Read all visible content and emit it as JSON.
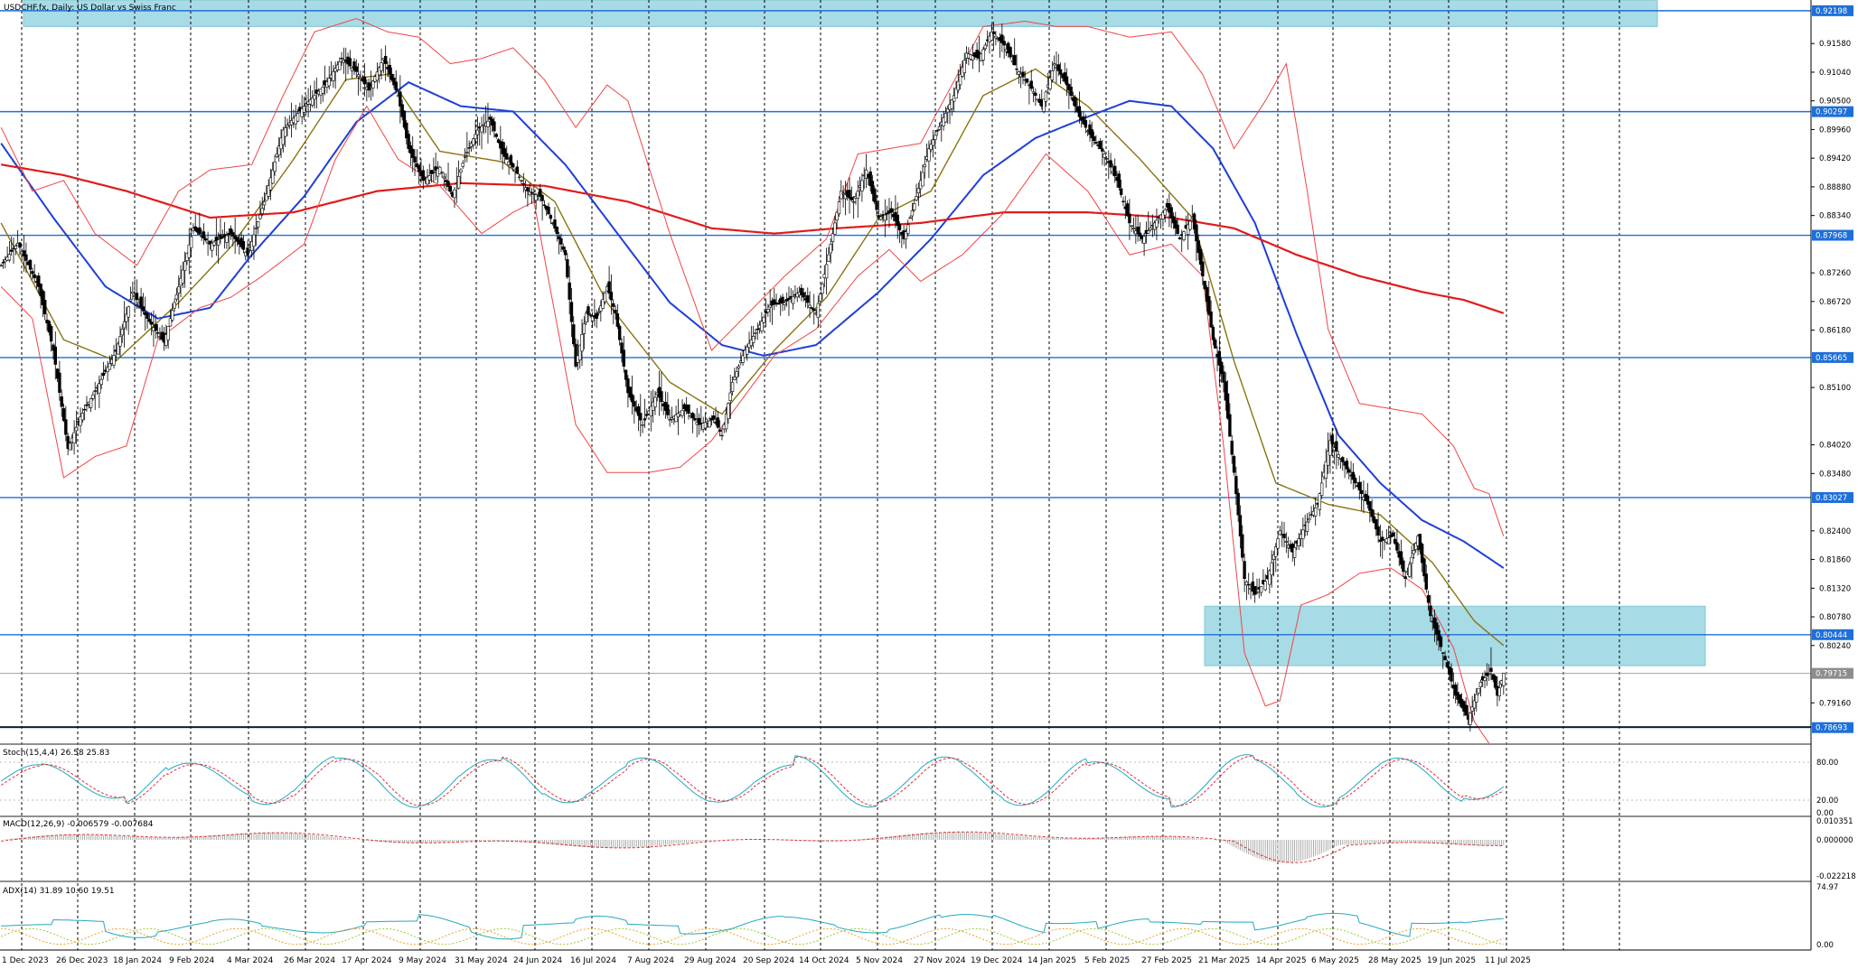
{
  "chart_data": {
    "type": "candlestick",
    "title": "USDCHF.fx, Daily:  US Dollar vs Swiss Franc",
    "ylim": [
      0.7845,
      0.924
    ],
    "price_ticks": [
      "0.91580",
      "0.91040",
      "0.90500",
      "0.89960",
      "0.89420",
      "0.88880",
      "0.88340",
      "0.87260",
      "0.86720",
      "0.86180",
      "0.85100",
      "0.84020",
      "0.83480",
      "0.82400",
      "0.81860",
      "0.81320",
      "0.80780",
      "0.80240",
      "0.79160"
    ],
    "price_tick_values": [
      0.9158,
      0.9104,
      0.905,
      0.8996,
      0.8942,
      0.8888,
      0.8834,
      0.8726,
      0.8672,
      0.8618,
      0.851,
      0.8402,
      0.8348,
      0.824,
      0.8186,
      0.8132,
      0.8078,
      0.8024,
      0.7916
    ],
    "horizontal_levels": [
      {
        "label": "0.92198",
        "value": 0.92198
      },
      {
        "label": "0.90297",
        "value": 0.90297
      },
      {
        "label": "0.87968",
        "value": 0.87968
      },
      {
        "label": "0.85665",
        "value": 0.85665
      },
      {
        "label": "0.83027",
        "value": 0.83027
      },
      {
        "label": "0.80444",
        "value": 0.80444
      }
    ],
    "current_price": {
      "label": "0.79715",
      "value": 0.79715
    },
    "low_marker": {
      "label": "0.78693",
      "value": 0.78693
    },
    "zones": [
      {
        "from_date": "1 Dec 2023",
        "to_date": "2 Aug 2025",
        "top": 0.924,
        "bottom": 0.919
      },
      {
        "from_date": "26 Mar 2025",
        "to_date": "1 Jul 2025 + 25d",
        "top": 0.8098,
        "bottom": 0.7986
      }
    ],
    "x_labels": [
      "1 Dec 2023",
      "26 Dec 2023",
      "18 Jan 2024",
      "9 Feb 2024",
      "4 Mar 2024",
      "26 Mar 2024",
      "17 Apr 2024",
      "9 May 2024",
      "31 May 2024",
      "24 Jun 2024",
      "16 Jul 2024",
      "7 Aug 2024",
      "29 Aug 2024",
      "20 Sep 2024",
      "14 Oct 2024",
      "5 Nov 2024",
      "27 Nov 2024",
      "19 Dec 2024",
      "14 Jan 2025",
      "5 Feb 2025",
      "27 Feb 2025",
      "21 Mar 2025",
      "14 Apr 2025",
      "6 May 2025",
      "28 May 2025",
      "19 Jun 2025",
      "11 Jul 2025"
    ],
    "close_path": [
      [
        0,
        0.874
      ],
      [
        8,
        0.8782
      ],
      [
        18,
        0.87
      ],
      [
        25,
        0.858
      ],
      [
        32,
        0.8395
      ],
      [
        38,
        0.8455
      ],
      [
        46,
        0.851
      ],
      [
        55,
        0.8578
      ],
      [
        63,
        0.869
      ],
      [
        70,
        0.864
      ],
      [
        78,
        0.8595
      ],
      [
        85,
        0.87
      ],
      [
        92,
        0.881
      ],
      [
        100,
        0.878
      ],
      [
        110,
        0.88
      ],
      [
        118,
        0.876
      ],
      [
        126,
        0.886
      ],
      [
        135,
        0.8995
      ],
      [
        145,
        0.904
      ],
      [
        155,
        0.908
      ],
      [
        163,
        0.913
      ],
      [
        170,
        0.9105
      ],
      [
        176,
        0.907
      ],
      [
        183,
        0.913
      ],
      [
        190,
        0.906
      ],
      [
        195,
        0.896
      ],
      [
        202,
        0.89
      ],
      [
        210,
        0.8925
      ],
      [
        216,
        0.887
      ],
      [
        222,
        0.8945
      ],
      [
        228,
        0.8995
      ],
      [
        234,
        0.9015
      ],
      [
        240,
        0.895
      ],
      [
        246,
        0.892
      ],
      [
        252,
        0.888
      ],
      [
        258,
        0.887
      ],
      [
        264,
        0.882
      ],
      [
        270,
        0.876
      ],
      [
        275,
        0.855
      ],
      [
        280,
        0.865
      ],
      [
        285,
        0.864
      ],
      [
        290,
        0.87
      ],
      [
        294,
        0.865
      ],
      [
        300,
        0.85
      ],
      [
        307,
        0.844
      ],
      [
        314,
        0.85
      ],
      [
        320,
        0.845
      ],
      [
        327,
        0.847
      ],
      [
        334,
        0.844
      ],
      [
        341,
        0.845
      ],
      [
        345,
        0.842
      ],
      [
        350,
        0.852
      ],
      [
        356,
        0.858
      ],
      [
        362,
        0.862
      ],
      [
        368,
        0.8665
      ],
      [
        375,
        0.867
      ],
      [
        382,
        0.869
      ],
      [
        390,
        0.865
      ],
      [
        396,
        0.876
      ],
      [
        402,
        0.888
      ],
      [
        408,
        0.886
      ],
      [
        414,
        0.892
      ],
      [
        420,
        0.883
      ],
      [
        426,
        0.884
      ],
      [
        432,
        0.879
      ],
      [
        438,
        0.887
      ],
      [
        444,
        0.896
      ],
      [
        450,
        0.901
      ],
      [
        456,
        0.906
      ],
      [
        462,
        0.914
      ],
      [
        468,
        0.913
      ],
      [
        474,
        0.918
      ],
      [
        480,
        0.9155
      ],
      [
        486,
        0.911
      ],
      [
        492,
        0.908
      ],
      [
        498,
        0.904
      ],
      [
        504,
        0.912
      ],
      [
        510,
        0.908
      ],
      [
        516,
        0.902
      ],
      [
        522,
        0.898
      ],
      [
        528,
        0.895
      ],
      [
        534,
        0.89
      ],
      [
        540,
        0.882
      ],
      [
        546,
        0.879
      ],
      [
        552,
        0.882
      ],
      [
        558,
        0.885
      ],
      [
        564,
        0.879
      ],
      [
        570,
        0.883
      ],
      [
        575,
        0.872
      ],
      [
        580,
        0.86
      ],
      [
        585,
        0.852
      ],
      [
        590,
        0.835
      ],
      [
        595,
        0.815
      ],
      [
        600,
        0.812
      ],
      [
        606,
        0.815
      ],
      [
        612,
        0.824
      ],
      [
        618,
        0.82
      ],
      [
        624,
        0.825
      ],
      [
        630,
        0.829
      ],
      [
        636,
        0.841
      ],
      [
        642,
        0.837
      ],
      [
        648,
        0.833
      ],
      [
        654,
        0.829
      ],
      [
        660,
        0.822
      ],
      [
        666,
        0.823
      ],
      [
        672,
        0.815
      ],
      [
        678,
        0.823
      ],
      [
        684,
        0.808
      ],
      [
        690,
        0.801
      ],
      [
        696,
        0.793
      ],
      [
        702,
        0.7885
      ],
      [
        708,
        0.7955
      ],
      [
        713,
        0.7975
      ],
      [
        716,
        0.793
      ],
      [
        719,
        0.7972
      ]
    ],
    "series": [
      {
        "name": "EMA 21 (olive)",
        "values": [
          [
            0,
            0.882
          ],
          [
            30,
            0.86
          ],
          [
            55,
            0.856
          ],
          [
            85,
            0.867
          ],
          [
            110,
            0.8775
          ],
          [
            140,
            0.894
          ],
          [
            165,
            0.909
          ],
          [
            185,
            0.91
          ],
          [
            210,
            0.8955
          ],
          [
            240,
            0.8935
          ],
          [
            265,
            0.886
          ],
          [
            290,
            0.867
          ],
          [
            320,
            0.852
          ],
          [
            345,
            0.846
          ],
          [
            370,
            0.858
          ],
          [
            395,
            0.868
          ],
          [
            420,
            0.883
          ],
          [
            445,
            0.888
          ],
          [
            470,
            0.906
          ],
          [
            495,
            0.911
          ],
          [
            520,
            0.904
          ],
          [
            545,
            0.894
          ],
          [
            570,
            0.883
          ],
          [
            590,
            0.856
          ],
          [
            610,
            0.833
          ],
          [
            635,
            0.829
          ],
          [
            660,
            0.827
          ],
          [
            685,
            0.818
          ],
          [
            705,
            0.807
          ],
          [
            719,
            0.8024
          ]
        ]
      },
      {
        "name": "EMA 50 (blue)",
        "values": [
          [
            0,
            0.897
          ],
          [
            25,
            0.883
          ],
          [
            50,
            0.87
          ],
          [
            75,
            0.864
          ],
          [
            100,
            0.866
          ],
          [
            120,
            0.876
          ],
          [
            145,
            0.887
          ],
          [
            170,
            0.901
          ],
          [
            195,
            0.9085
          ],
          [
            220,
            0.904
          ],
          [
            245,
            0.903
          ],
          [
            270,
            0.893
          ],
          [
            295,
            0.88
          ],
          [
            320,
            0.867
          ],
          [
            345,
            0.859
          ],
          [
            365,
            0.857
          ],
          [
            390,
            0.859
          ],
          [
            420,
            0.869
          ],
          [
            445,
            0.879
          ],
          [
            470,
            0.891
          ],
          [
            495,
            0.898
          ],
          [
            520,
            0.902
          ],
          [
            540,
            0.905
          ],
          [
            560,
            0.904
          ],
          [
            580,
            0.896
          ],
          [
            600,
            0.882
          ],
          [
            620,
            0.861
          ],
          [
            640,
            0.842
          ],
          [
            660,
            0.833
          ],
          [
            680,
            0.826
          ],
          [
            700,
            0.822
          ],
          [
            719,
            0.817
          ]
        ]
      },
      {
        "name": "EMA 200 (red)",
        "values": [
          [
            0,
            0.893
          ],
          [
            30,
            0.891
          ],
          [
            60,
            0.888
          ],
          [
            100,
            0.883
          ],
          [
            140,
            0.884
          ],
          [
            180,
            0.888
          ],
          [
            220,
            0.8895
          ],
          [
            260,
            0.889
          ],
          [
            300,
            0.886
          ],
          [
            340,
            0.881
          ],
          [
            370,
            0.88
          ],
          [
            400,
            0.881
          ],
          [
            440,
            0.882
          ],
          [
            480,
            0.884
          ],
          [
            520,
            0.884
          ],
          [
            560,
            0.883
          ],
          [
            590,
            0.881
          ],
          [
            620,
            0.876
          ],
          [
            650,
            0.872
          ],
          [
            680,
            0.869
          ],
          [
            700,
            0.8675
          ],
          [
            719,
            0.865
          ]
        ]
      },
      {
        "name": "Bollinger upper",
        "values": [
          [
            0,
            0.9
          ],
          [
            15,
            0.888
          ],
          [
            30,
            0.89
          ],
          [
            45,
            0.88
          ],
          [
            65,
            0.874
          ],
          [
            85,
            0.888
          ],
          [
            100,
            0.892
          ],
          [
            120,
            0.893
          ],
          [
            135,
            0.906
          ],
          [
            150,
            0.918
          ],
          [
            170,
            0.9205
          ],
          [
            185,
            0.918
          ],
          [
            200,
            0.917
          ],
          [
            215,
            0.912
          ],
          [
            230,
            0.913
          ],
          [
            245,
            0.915
          ],
          [
            260,
            0.909
          ],
          [
            275,
            0.9
          ],
          [
            290,
            0.908
          ],
          [
            300,
            0.905
          ],
          [
            320,
            0.88
          ],
          [
            340,
            0.858
          ],
          [
            355,
            0.864
          ],
          [
            375,
            0.872
          ],
          [
            395,
            0.879
          ],
          [
            410,
            0.895
          ],
          [
            425,
            0.896
          ],
          [
            440,
            0.897
          ],
          [
            455,
            0.908
          ],
          [
            470,
            0.919
          ],
          [
            490,
            0.92
          ],
          [
            505,
            0.919
          ],
          [
            520,
            0.919
          ],
          [
            540,
            0.917
          ],
          [
            560,
            0.918
          ],
          [
            575,
            0.91
          ],
          [
            590,
            0.896
          ],
          [
            605,
            0.905
          ],
          [
            615,
            0.912
          ],
          [
            625,
            0.888
          ],
          [
            635,
            0.862
          ],
          [
            650,
            0.848
          ],
          [
            665,
            0.847
          ],
          [
            680,
            0.846
          ],
          [
            695,
            0.84
          ],
          [
            705,
            0.832
          ],
          [
            712,
            0.831
          ],
          [
            719,
            0.823
          ]
        ]
      },
      {
        "name": "Bollinger lower",
        "values": [
          [
            0,
            0.87
          ],
          [
            15,
            0.864
          ],
          [
            30,
            0.834
          ],
          [
            45,
            0.838
          ],
          [
            60,
            0.84
          ],
          [
            75,
            0.86
          ],
          [
            95,
            0.866
          ],
          [
            110,
            0.868
          ],
          [
            125,
            0.872
          ],
          [
            145,
            0.878
          ],
          [
            160,
            0.894
          ],
          [
            175,
            0.904
          ],
          [
            190,
            0.894
          ],
          [
            210,
            0.889
          ],
          [
            230,
            0.88
          ],
          [
            245,
            0.884
          ],
          [
            255,
            0.886
          ],
          [
            275,
            0.844
          ],
          [
            290,
            0.835
          ],
          [
            310,
            0.835
          ],
          [
            325,
            0.836
          ],
          [
            340,
            0.841
          ],
          [
            355,
            0.849
          ],
          [
            370,
            0.857
          ],
          [
            390,
            0.862
          ],
          [
            410,
            0.872
          ],
          [
            425,
            0.877
          ],
          [
            440,
            0.871
          ],
          [
            460,
            0.876
          ],
          [
            480,
            0.884
          ],
          [
            500,
            0.895
          ],
          [
            520,
            0.888
          ],
          [
            540,
            0.876
          ],
          [
            560,
            0.878
          ],
          [
            575,
            0.872
          ],
          [
            585,
            0.84
          ],
          [
            595,
            0.801
          ],
          [
            605,
            0.791
          ],
          [
            612,
            0.792
          ],
          [
            622,
            0.81
          ],
          [
            635,
            0.812
          ],
          [
            650,
            0.816
          ],
          [
            665,
            0.817
          ],
          [
            680,
            0.813
          ],
          [
            695,
            0.802
          ],
          [
            705,
            0.788
          ],
          [
            712,
            0.784
          ]
        ]
      }
    ],
    "indicators": [
      {
        "name": "Stoch",
        "label": "Stoch(15,4,4) 26.58 25.83",
        "ticks": [
          "80.00",
          "20.00",
          "0.00"
        ]
      },
      {
        "name": "MACD",
        "label": "MACD(12,26,9) -0.006579 -0.007684",
        "ticks": [
          "0.010351",
          "0.000000",
          "-0.022218"
        ]
      },
      {
        "name": "ADX",
        "label": "ADX(14) 31.89 10.60 19.51",
        "ticks": [
          "74.97",
          "0.00"
        ]
      }
    ]
  }
}
